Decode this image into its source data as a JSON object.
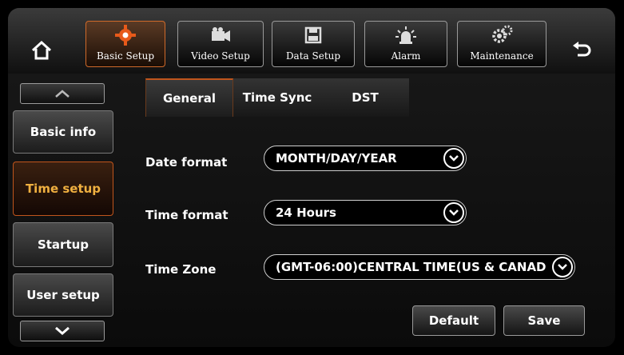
{
  "topnav": {
    "tabs": [
      {
        "label": "Basic Setup",
        "icon": "gear-icon"
      },
      {
        "label": "Video Setup",
        "icon": "video-camera-icon"
      },
      {
        "label": "Data Setup",
        "icon": "floppy-disk-icon"
      },
      {
        "label": "Alarm",
        "icon": "alarm-light-icon"
      },
      {
        "label": "Maintenance",
        "icon": "gears-icon"
      }
    ],
    "active_index": 0,
    "home_icon": "home-icon",
    "back_icon": "back-arrow-icon"
  },
  "sidebar": {
    "items": [
      {
        "label": "Basic info"
      },
      {
        "label": "Time setup"
      },
      {
        "label": "Startup"
      },
      {
        "label": "User setup"
      }
    ],
    "active_index": 1,
    "up_icon": "chevron-up-icon",
    "down_icon": "chevron-down-icon"
  },
  "tabs": [
    {
      "label": "General"
    },
    {
      "label": "Time Sync"
    },
    {
      "label": "DST"
    }
  ],
  "active_tab": 0,
  "fields": {
    "date_format": {
      "label": "Date format",
      "value": "MONTH/DAY/YEAR"
    },
    "time_format": {
      "label": "Time format",
      "value": "24 Hours"
    },
    "time_zone": {
      "label": "Time Zone",
      "value": "(GMT-06:00)CENTRAL TIME(US & CANAD"
    }
  },
  "actions": {
    "default_label": "Default",
    "save_label": "Save"
  },
  "colors": {
    "accent": "#c0551c",
    "active_text": "#f0b040",
    "background": "#0b0b0b"
  }
}
